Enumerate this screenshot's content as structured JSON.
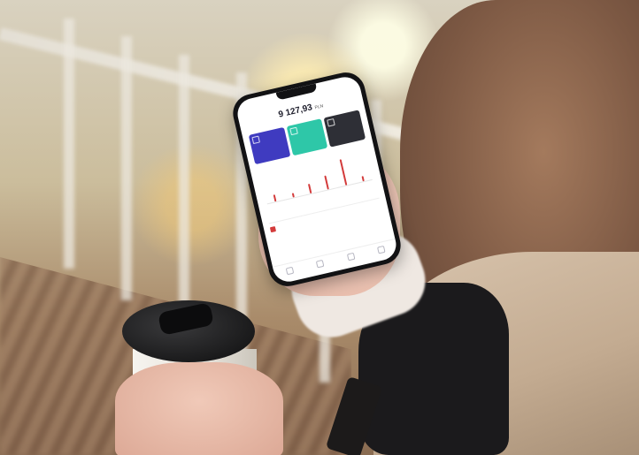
{
  "phone_app": {
    "balance": "9 127,93",
    "currency": "PLN"
  },
  "chart_data": {
    "type": "bar",
    "values": [
      0.25,
      0.15,
      0.35,
      0.5,
      0.95,
      0.2
    ],
    "colors": {
      "bar": "#d33b3b"
    }
  },
  "colors": {
    "card_blue": "#3f3bc0",
    "card_teal": "#2ec7a8",
    "card_dark": "#2e2f36"
  }
}
